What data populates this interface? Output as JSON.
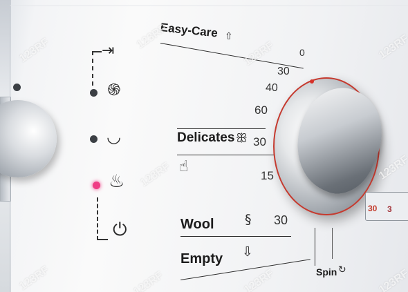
{
  "panel": {
    "title": "Easy-Care",
    "delicates": "Delicates",
    "wool": "Wool",
    "empty": "Empty",
    "spin": "Spin"
  },
  "temperatures": [
    "0",
    "30",
    "40",
    "60",
    "30",
    "15",
    "30"
  ],
  "right_edge": {
    "number_a": "30",
    "number_b": "3"
  },
  "watermark": "123RF",
  "colors": {
    "dial_ring": "#c53a2f",
    "active_led": "#ef3d85"
  },
  "icons": {
    "skip": "skip-to-end-icon",
    "spiral": "spiral-spin-icon",
    "tub": "wash-tub-icon",
    "prewash": "prewash-icon",
    "power": "power-icon",
    "butterfly": "butterfly-icon",
    "handwash": "hand-wash-icon",
    "yarn": "yarn-icon",
    "drain": "drain-icon"
  }
}
